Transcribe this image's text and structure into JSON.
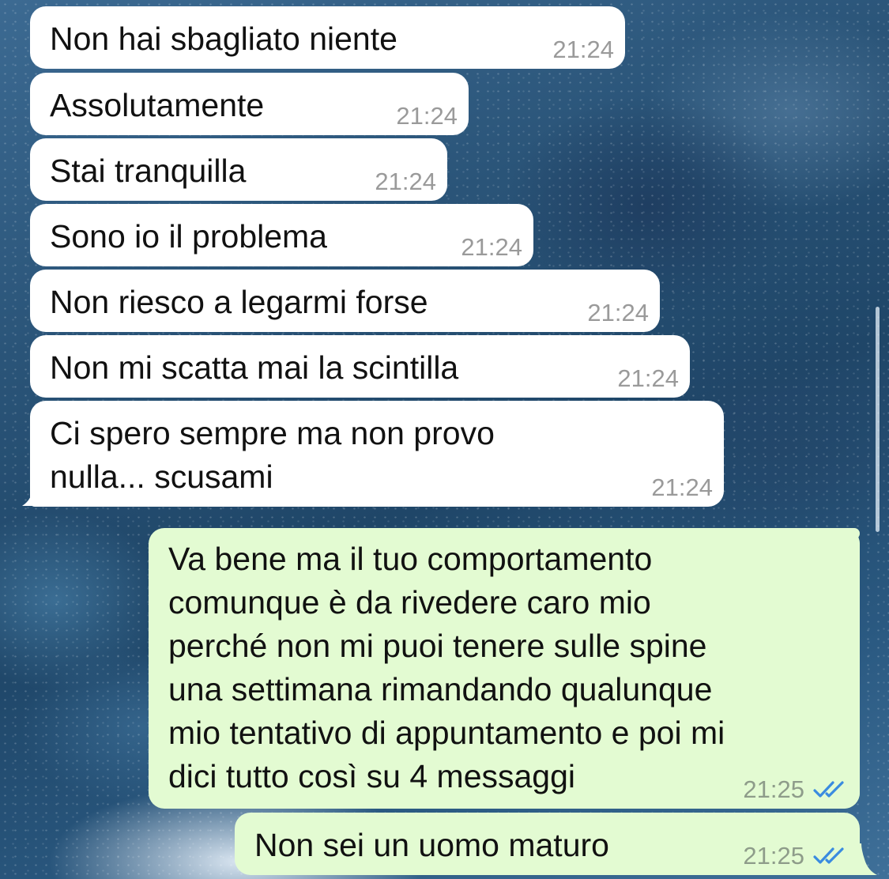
{
  "messages": [
    {
      "direction": "incoming",
      "text": "Non hai sbagliato niente",
      "time": "21:24"
    },
    {
      "direction": "incoming",
      "text": "Assolutamente",
      "time": "21:24"
    },
    {
      "direction": "incoming",
      "text": "Stai tranquilla",
      "time": "21:24"
    },
    {
      "direction": "incoming",
      "text": "Sono io il problema",
      "time": "21:24"
    },
    {
      "direction": "incoming",
      "text": "Non riesco a legarmi forse",
      "time": "21:24"
    },
    {
      "direction": "incoming",
      "text": "Non mi scatta mai la scintilla",
      "time": "21:24"
    },
    {
      "direction": "incoming",
      "lines": [
        "Ci spero sempre ma non provo",
        "nulla... scusami"
      ],
      "time": "21:24"
    },
    {
      "direction": "outgoing",
      "lines": [
        "Va bene ma il tuo comportamento",
        "comunque è da rivedere caro mio",
        "perché non mi puoi tenere sulle spine",
        "una settimana rimandando qualunque",
        "mio tentativo di appuntamento e poi mi",
        "dici tutto così su 4 messaggi"
      ],
      "time": "21:25",
      "status": "read-double-check-icon"
    },
    {
      "direction": "outgoing",
      "text": "Non sei un uomo maturo",
      "time": "21:25",
      "status": "read-double-check-icon"
    }
  ],
  "colors": {
    "incoming_bubble": "#ffffff",
    "outgoing_bubble": "#e3fbd2",
    "read_ticks": "#3a8be0"
  }
}
